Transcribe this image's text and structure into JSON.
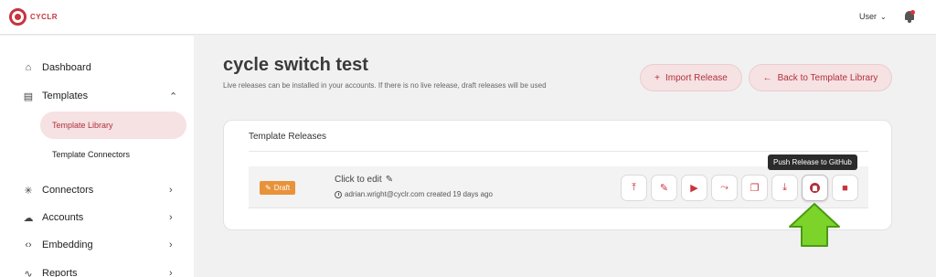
{
  "app": {
    "logo_text": "CYCLR",
    "brand_color": "#c8343e"
  },
  "header": {
    "user_label": "User",
    "user_chevron": "⌄"
  },
  "sidebar": {
    "items": [
      {
        "label": "Dashboard",
        "icon": "home-icon",
        "glyph": "⌂"
      },
      {
        "label": "Templates",
        "icon": "templates-icon",
        "glyph": "▤",
        "chevron": "⌃"
      },
      {
        "label": "Connectors",
        "icon": "connectors-icon",
        "glyph": "✳",
        "chevron": "›"
      },
      {
        "label": "Accounts",
        "icon": "cloud-icon",
        "glyph": "☁",
        "chevron": "›"
      },
      {
        "label": "Embedding",
        "icon": "code-icon",
        "glyph": "‹›",
        "chevron": "›"
      },
      {
        "label": "Reports",
        "icon": "reports-icon",
        "glyph": "∿",
        "chevron": "›"
      }
    ],
    "sub_items": [
      {
        "label": "Template Library",
        "active": true
      },
      {
        "label": "Template Connectors",
        "active": false
      }
    ]
  },
  "main": {
    "title": "cycle switch test",
    "description": "Live releases can be installed in your accounts. If there is no live release, draft releases will be used",
    "import_button": {
      "icon": "+",
      "label": "Import Release"
    },
    "back_button": {
      "icon": "←",
      "label": "Back to Template Library"
    },
    "card": {
      "title": "Template Releases",
      "release": {
        "badge": "Draft",
        "badge_icon": "✎",
        "name": "Click to edit",
        "name_icon": "✎",
        "author": "adrian.wright@cyclr.com created 19 days ago"
      },
      "actions": [
        {
          "name": "publish-release",
          "icon": "publish-icon",
          "glyph": "⤒"
        },
        {
          "name": "edit-release",
          "icon": "pencil-icon",
          "glyph": "✎"
        },
        {
          "name": "run-release",
          "icon": "play-icon",
          "glyph": "▶"
        },
        {
          "name": "test-release",
          "icon": "test-icon",
          "glyph": "⤳"
        },
        {
          "name": "copy-release",
          "icon": "copy-icon",
          "glyph": "❐"
        },
        {
          "name": "download-release",
          "icon": "download-icon",
          "glyph": "⤓"
        },
        {
          "name": "push-github",
          "icon": "github-icon",
          "glyph": ""
        },
        {
          "name": "delete-release",
          "icon": "trash-icon",
          "glyph": "■"
        }
      ]
    },
    "tooltip": "Push Release to GitHub"
  },
  "annotation": {
    "arrow_color": "#7cd42a",
    "arrow_outline": "#4a9a12"
  }
}
